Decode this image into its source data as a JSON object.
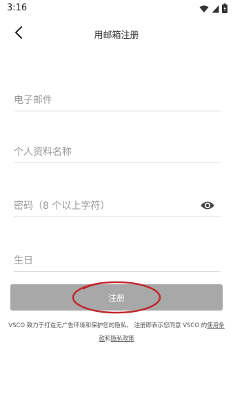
{
  "status_bar": {
    "time": "3:16"
  },
  "nav": {
    "title": "用邮箱注册"
  },
  "form": {
    "email_placeholder": "电子邮件",
    "name_placeholder": "个人资料名称",
    "password_placeholder": "密码（8 个以上字符）",
    "birthday_placeholder": "生日",
    "email_value": "",
    "name_value": "",
    "password_value": "",
    "birthday_value": ""
  },
  "register_label": "注册",
  "terms": {
    "prefix": "VSCO 致力于打造无广告环境和保护您的隐私。 注册即表示您同意 VSCO 的",
    "terms_link": "使用条款",
    "and": "和",
    "privacy_link": "隐私政策"
  },
  "colors": {
    "button_bg": "#a8a8a8",
    "annotation": "#c0272d"
  },
  "icons": [
    "chevron-left-icon",
    "eye-icon",
    "wifi-icon",
    "signal-icon",
    "battery-icon"
  ]
}
